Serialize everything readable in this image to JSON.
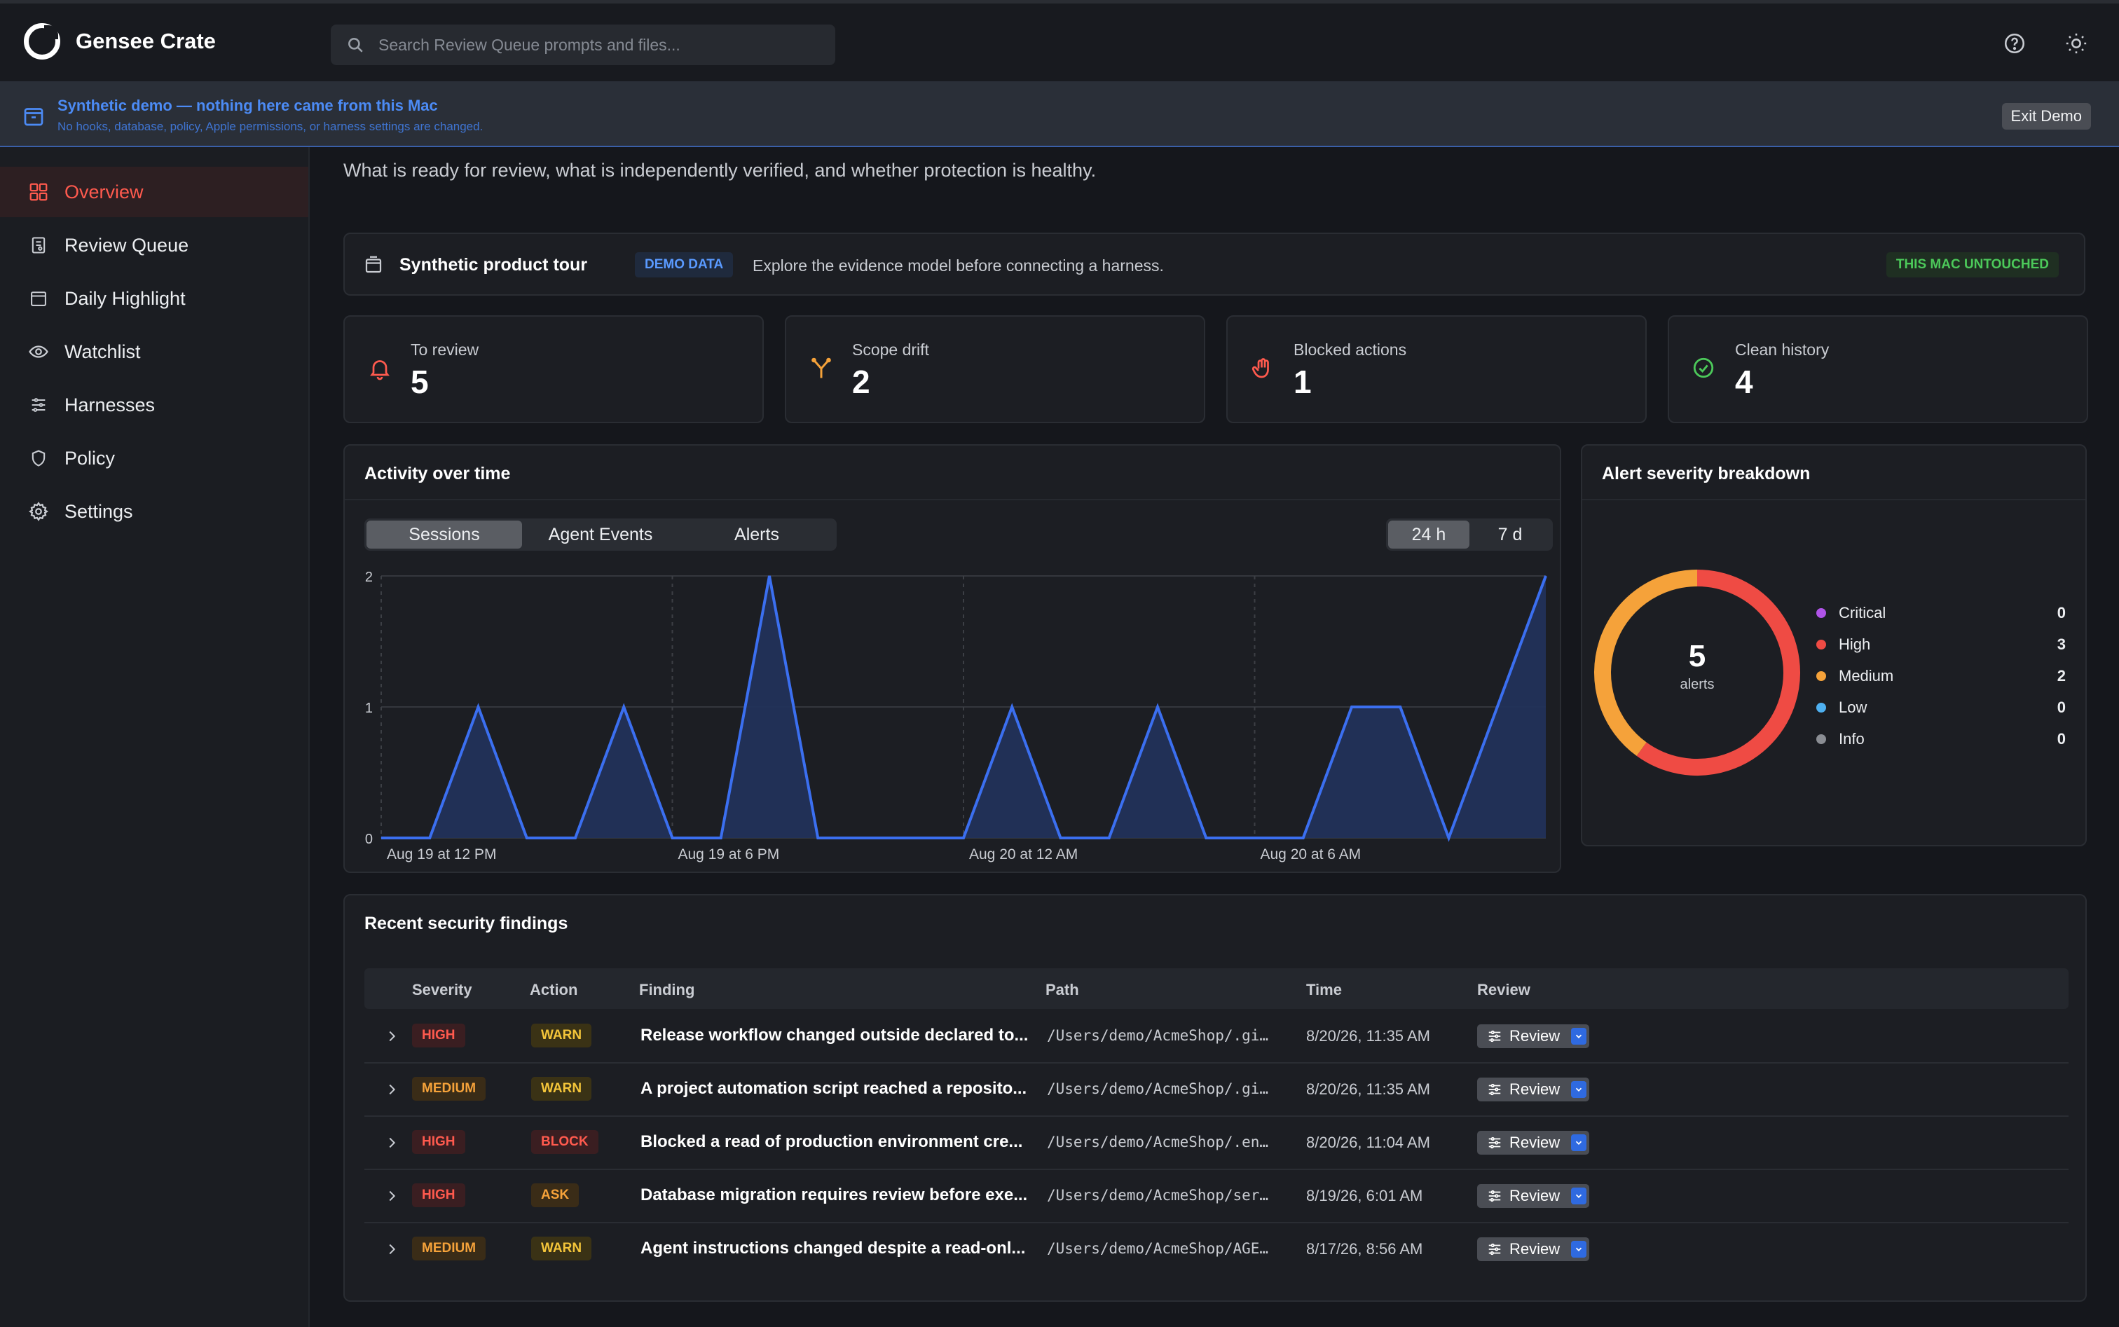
{
  "app": {
    "name": "Gensee Crate"
  },
  "search": {
    "placeholder": "Search Review Queue prompts and files..."
  },
  "banner": {
    "title": "Synthetic demo — nothing here came from this Mac",
    "subtitle": "No hooks, database, policy, Apple permissions, or harness settings are changed.",
    "exit_label": "Exit Demo"
  },
  "sidebar": {
    "items": [
      {
        "label": "Overview",
        "icon": "grid-icon",
        "active": true
      },
      {
        "label": "Review Queue",
        "icon": "document-icon"
      },
      {
        "label": "Daily Highlight",
        "icon": "calendar-icon"
      },
      {
        "label": "Watchlist",
        "icon": "eye-icon"
      },
      {
        "label": "Harnesses",
        "icon": "sliders-icon"
      },
      {
        "label": "Policy",
        "icon": "shield-icon"
      },
      {
        "label": "Settings",
        "icon": "gear-icon"
      }
    ]
  },
  "overview": {
    "subtitle": "What is ready for review, what is independently verified, and whether protection is healthy."
  },
  "tour": {
    "title": "Synthetic product tour",
    "badge": "DEMO DATA",
    "text": "Explore the evidence model before connecting a harness.",
    "status": "THIS MAC UNTOUCHED"
  },
  "stats": [
    {
      "label": "To review",
      "value": "5",
      "icon": "bell-icon",
      "color": "#ff5a4e"
    },
    {
      "label": "Scope drift",
      "value": "2",
      "icon": "fork-icon",
      "color": "#f5a23a"
    },
    {
      "label": "Blocked actions",
      "value": "1",
      "icon": "hand-icon",
      "color": "#ff5a4e"
    },
    {
      "label": "Clean history",
      "value": "4",
      "icon": "check-circle-icon",
      "color": "#4cc95a"
    }
  ],
  "activity": {
    "title": "Activity over time",
    "tabs": [
      "Sessions",
      "Agent Events",
      "Alerts"
    ],
    "selected_tab": "Sessions",
    "ranges": [
      "24 h",
      "7 d"
    ],
    "selected_range": "24 h"
  },
  "severity": {
    "title": "Alert severity breakdown",
    "total": "5",
    "total_label": "alerts"
  },
  "chart_data": [
    {
      "type": "area",
      "title": "Activity over time",
      "series": [
        {
          "values": [
            0,
            0,
            1,
            0,
            0,
            1,
            0,
            0,
            2,
            0,
            0,
            0,
            0,
            1,
            0,
            0,
            1,
            0,
            0,
            0,
            1,
            1,
            0,
            1,
            2
          ]
        }
      ],
      "x_tick_labels": [
        "Aug 19 at 12 PM",
        "Aug 19 at 6 PM",
        "Aug 20 at 12 AM",
        "Aug 20 at 6 AM"
      ],
      "y_ticks": [
        0,
        1,
        2
      ],
      "ylim": [
        0,
        2
      ],
      "grid": true,
      "color": "#3b6ff0"
    },
    {
      "type": "pie",
      "title": "Alert severity breakdown",
      "categories": [
        "Critical",
        "High",
        "Medium",
        "Low",
        "Info"
      ],
      "values": [
        0,
        3,
        2,
        0,
        0
      ],
      "colors": [
        "#b054e8",
        "#ef4b44",
        "#f5a23a",
        "#4eb0f0",
        "#8a8d93"
      ]
    }
  ],
  "findings": {
    "title": "Recent security findings",
    "columns": [
      "Severity",
      "Action",
      "Finding",
      "Path",
      "Time",
      "Review"
    ],
    "review_label": "Review",
    "rows": [
      {
        "severity": "HIGH",
        "action": "WARN",
        "finding": "Release workflow changed outside declared to...",
        "path": "/Users/demo/AcmeShop/.gi…",
        "time": "8/20/26, 11:35 AM"
      },
      {
        "severity": "MEDIUM",
        "action": "WARN",
        "finding": "A project automation script reached a reposito...",
        "path": "/Users/demo/AcmeShop/.gi…",
        "time": "8/20/26, 11:35 AM"
      },
      {
        "severity": "HIGH",
        "action": "BLOCK",
        "finding": "Blocked a read of production environment cre...",
        "path": "/Users/demo/AcmeShop/.en…",
        "time": "8/20/26, 11:04 AM"
      },
      {
        "severity": "HIGH",
        "action": "ASK",
        "finding": "Database migration requires review before exe...",
        "path": "/Users/demo/AcmeShop/ser…",
        "time": "8/19/26, 6:01 AM"
      },
      {
        "severity": "MEDIUM",
        "action": "WARN",
        "finding": "Agent instructions changed despite a read-onl...",
        "path": "/Users/demo/AcmeShop/AGE…",
        "time": "8/17/26, 8:56 AM"
      }
    ]
  }
}
